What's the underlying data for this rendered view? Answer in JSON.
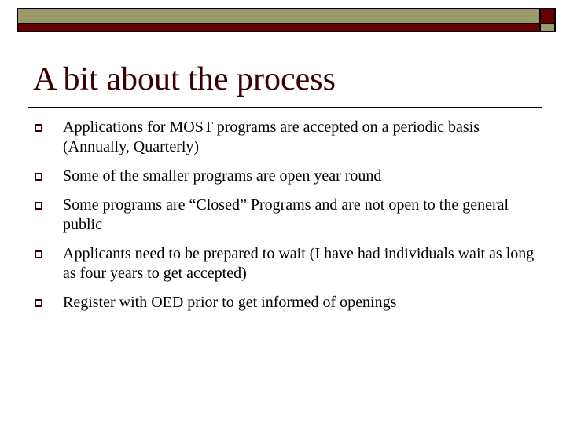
{
  "slide": {
    "title": "A bit about the process",
    "bullets": [
      {
        "text": "Applications for MOST programs are accepted on a periodic basis (Annually, Quarterly)"
      },
      {
        "text": "Some of the smaller programs are open year round"
      },
      {
        "text": "Some programs are “Closed” Programs and are not open to the general public"
      },
      {
        "text": "Applicants need to be prepared to wait (I have had individuals wait as long as four years to get accepted)"
      },
      {
        "text": "Register with OED prior to get informed of openings"
      }
    ],
    "bullet_icon": "hollow-square-icon"
  },
  "theme": {
    "olive": "#99996a",
    "maroon": "#660000",
    "title_color": "#3a0000",
    "text_color": "#000000"
  }
}
